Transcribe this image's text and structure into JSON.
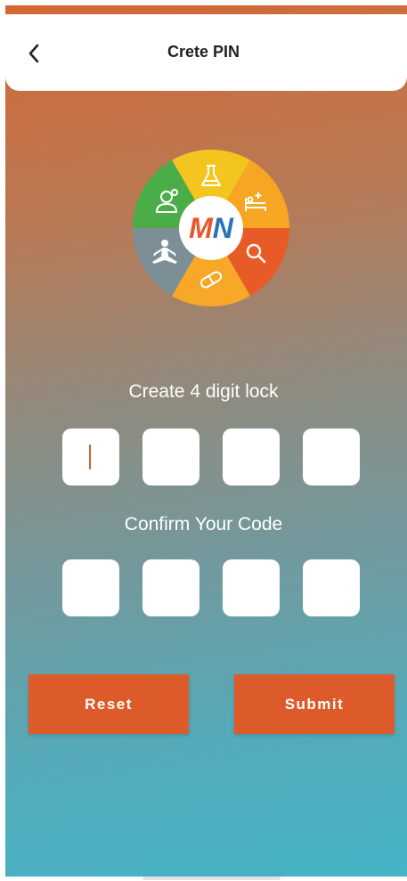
{
  "header": {
    "title": "Crete PIN",
    "back_icon": "chevron-left-icon"
  },
  "logo": {
    "text": "MN",
    "segments": [
      {
        "icon": "flask-icon",
        "color": "#f4c51f"
      },
      {
        "icon": "hospital-bed-icon",
        "color": "#f6a623"
      },
      {
        "icon": "search-icon",
        "color": "#e85b26"
      },
      {
        "icon": "pills-icon",
        "color": "#f7a828"
      },
      {
        "icon": "yoga-icon",
        "color": "#7c8f96"
      },
      {
        "icon": "doctor-icon",
        "color": "#4bad48"
      }
    ],
    "text_colors": {
      "m": "#e8572b",
      "n": "#2a72b8"
    }
  },
  "create": {
    "label": "Create 4 digit lock",
    "digits": [
      "",
      "",
      "",
      ""
    ]
  },
  "confirm": {
    "label": "Confirm Your Code",
    "digits": [
      "",
      "",
      "",
      ""
    ]
  },
  "buttons": {
    "reset": "Reset",
    "submit": "Submit"
  },
  "colors": {
    "accent": "#dd5b2a",
    "gradient_top": "#d46834",
    "gradient_bottom": "#44b4c6"
  }
}
